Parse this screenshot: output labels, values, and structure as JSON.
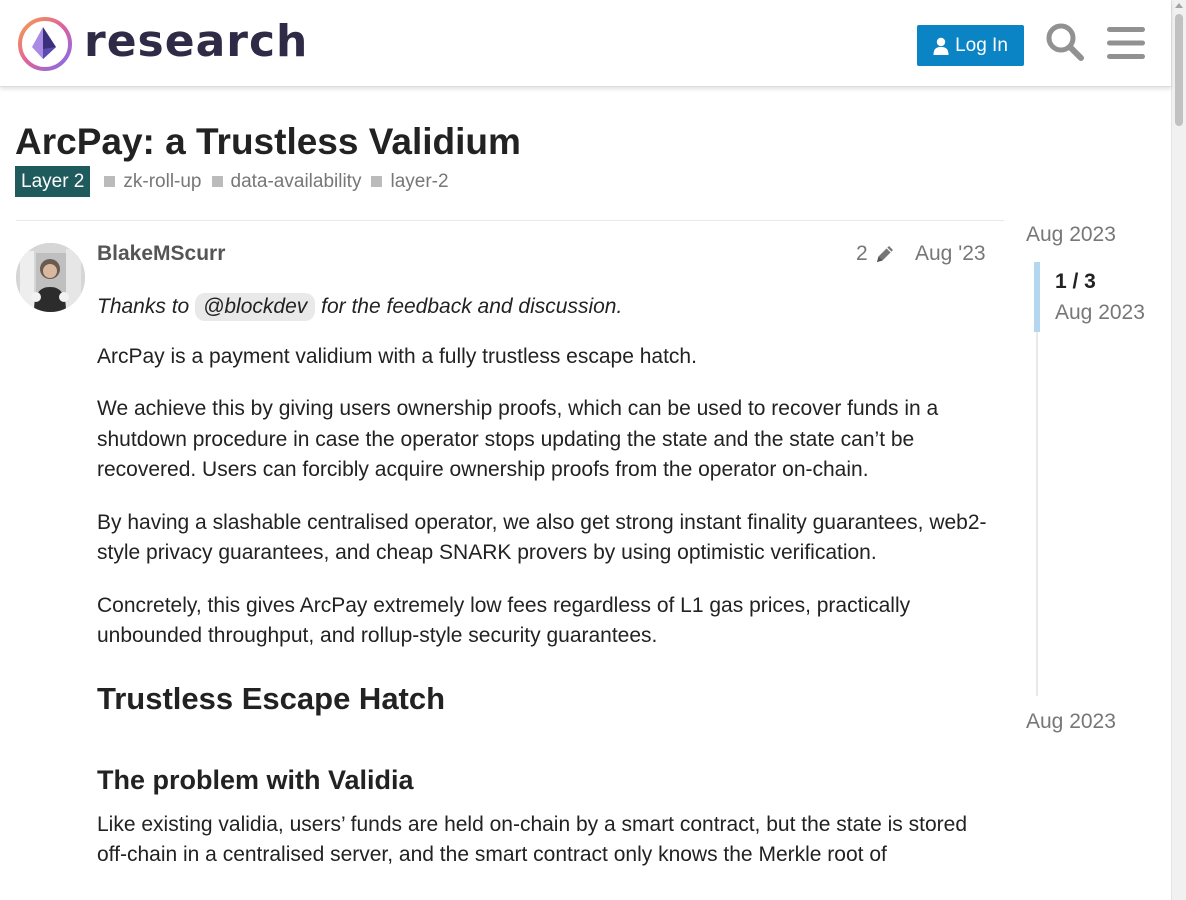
{
  "header": {
    "logo_text": "research",
    "login_label": "Log In",
    "search_icon": "search-icon",
    "menu_icon": "hamburger-menu-icon"
  },
  "topic": {
    "title": "ArcPay: a Trustless Validium",
    "category": "Layer 2",
    "tags": [
      "zk-roll-up",
      "data-availability",
      "layer-2"
    ]
  },
  "post": {
    "username": "BlakeMScurr",
    "edit_count": "2",
    "date": "Aug '23",
    "thanks_prefix": "Thanks to",
    "mention": "@blockdev",
    "thanks_suffix": "for the feedback and discussion.",
    "paragraphs": [
      "ArcPay is a payment validium with a fully trustless escape hatch.",
      "We achieve this by giving users ownership proofs, which can be used to recover funds in a shutdown procedure in case the operator stops updating the state and the state can’t be recovered. Users can forcibly acquire ownership proofs from the operator on-chain.",
      "By having a slashable centralised operator, we also get strong instant finality guarantees, web2-style privacy guarantees, and cheap SNARK provers by using optimistic verification.",
      "Concretely, this gives ArcPay extremely low fees regardless of L1 gas prices, practically unbounded throughput, and rollup-style security guarantees."
    ],
    "heading_1": "Trustless Escape Hatch",
    "heading_2": "The problem with Validia",
    "final_paragraph": "Like existing validia, users’ funds are held on-chain by a smart contract, but the state is stored off-chain in a centralised server, and the smart contract only knows the Merkle root of"
  },
  "timeline": {
    "start_date": "Aug 2023",
    "progress": "1 / 3",
    "current_date": "Aug 2023",
    "end_date": "Aug 2023"
  },
  "colors": {
    "accent": "#0a84c4",
    "category": "#1f5a5d",
    "timeline_handle": "#b3d7ee"
  }
}
